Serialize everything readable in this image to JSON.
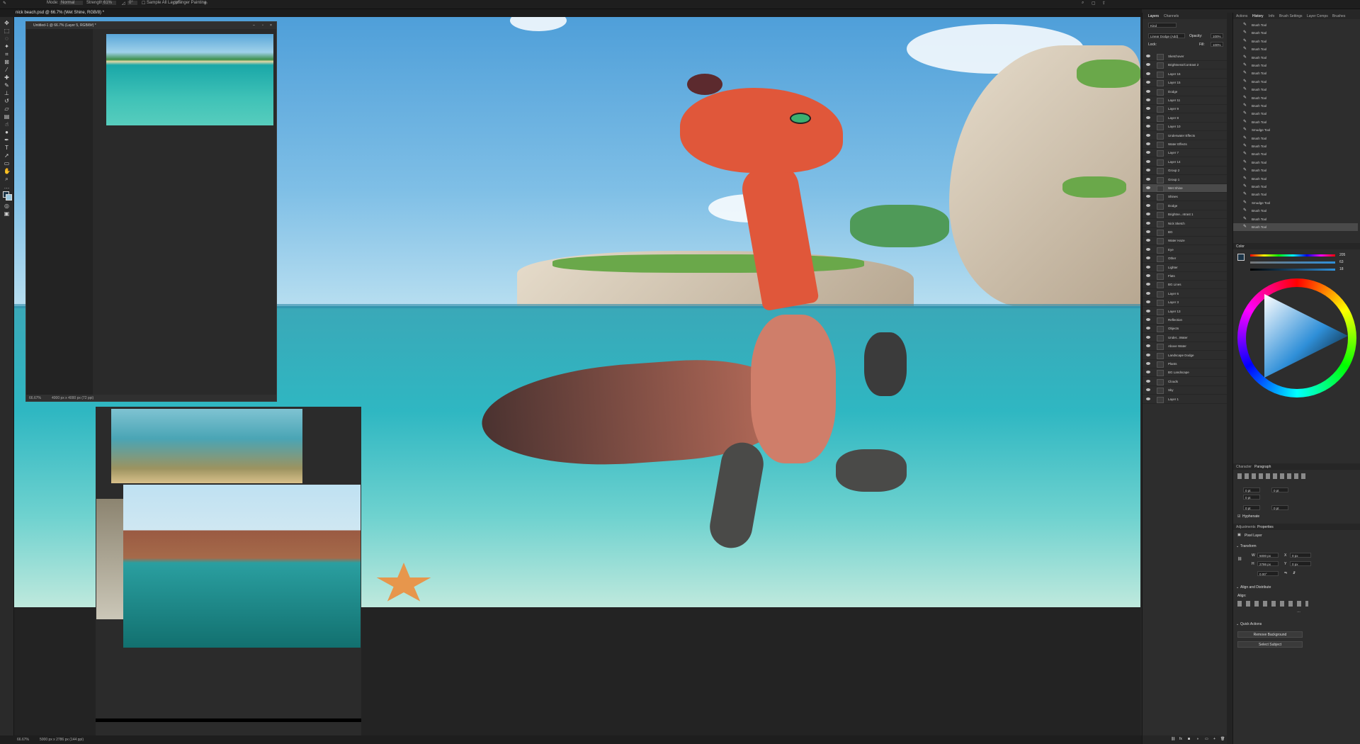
{
  "optionsbar": {
    "mode_label": "Mode:",
    "mode_value": "Normal",
    "strength_label": "Strength:",
    "strength_value": "61%",
    "angle_value": "0°",
    "sample_all_layers": "Sample All Layers",
    "finger_painting": "Finger Painting"
  },
  "document": {
    "tab_title": "nick beach.psd @ 66.7% (Wet Shine, RGB/8) *",
    "status_zoom": "66.67%",
    "status_size": "5000 px x 2786 px (144 ppi)"
  },
  "ref_window": {
    "title": "Untitled-1 @ 66.7% (Layer 5, RGB/8#) *",
    "status_zoom": "66.67%",
    "status_size": "4000 px x 4000 px (72 ppi)"
  },
  "layers_panel": {
    "tabs": [
      "Layers",
      "Channels"
    ],
    "filter_kind": "Kind",
    "blend_mode": "Linear Dodge (Add)",
    "opacity_label": "Opacity:",
    "opacity_value": "100%",
    "lock_label": "Lock:",
    "fill_label": "Fill:",
    "fill_value": "100%",
    "layers": [
      "Sketchover",
      "Brightness/Contrast 2",
      "Layer 16",
      "Layer 15",
      "Dodge",
      "Layer 11",
      "Layer 9",
      "Layer 8",
      "Layer 10",
      "Underwater Effects",
      "Water Effects",
      "Layer 7",
      "Layer 14",
      "Group 2",
      "Group 1",
      "Wet Shine",
      "Shines",
      "Dodge",
      "Brightne...ntrast 1",
      "Nick Sketch",
      "BG",
      "Water Haze",
      "Eye",
      "Other",
      "Lighter",
      "Flats",
      "BG Lines",
      "Layer 6",
      "Layer 3",
      "Layer 13",
      "Reflection",
      "Objects",
      "Under...Water",
      "Above Water",
      "Landscape Dodge",
      "Plants",
      "BG Landscape",
      "Clouds",
      "Sky",
      "Layer 1"
    ]
  },
  "history_panel": {
    "tabs": [
      "Actions",
      "History",
      "Info",
      "Brush Settings",
      "Layer Comps",
      "Brushes"
    ],
    "items": [
      "Brush Tool",
      "Brush Tool",
      "Brush Tool",
      "Brush Tool",
      "Brush Tool",
      "Brush Tool",
      "Brush Tool",
      "Brush Tool",
      "Brush Tool",
      "Brush Tool",
      "Brush Tool",
      "Brush Tool",
      "Brush Tool",
      "Smudge Tool",
      "Brush Tool",
      "Brush Tool",
      "Brush Tool",
      "Brush Tool",
      "Brush Tool",
      "Brush Tool",
      "Brush Tool",
      "Brush Tool",
      "Smudge Tool",
      "Brush Tool",
      "Brush Tool",
      "Brush Tool"
    ]
  },
  "color_panel": {
    "title": "Color",
    "h_value": "205",
    "s_value": "63",
    "b_value": "18"
  },
  "paragraph_panel": {
    "tabs": [
      "Character",
      "Paragraph"
    ],
    "indent_values": [
      "0 pt",
      "0 pt",
      "0 pt",
      "0 pt",
      "0 pt"
    ],
    "hyphenate": "Hyphenate"
  },
  "properties_panel": {
    "tabs": [
      "Adjustments",
      "Properties"
    ],
    "layer_type": "Pixel Layer",
    "transform_title": "Transform",
    "w_label": "W",
    "w_value": "5000 px",
    "h_label": "H",
    "h_value": "2786 px",
    "x_label": "X",
    "x_value": "0 px",
    "y_label": "Y",
    "y_value": "0 px",
    "angle_value": "0.00°",
    "align_title": "Align and Distribute",
    "align_label": "Align:",
    "quick_actions_title": "Quick Actions",
    "remove_bg": "Remove Background",
    "select_subject": "Select Subject"
  },
  "colors": {
    "accent_wheel_blue": "#2f8fd8",
    "ui_dark": "#2d2d2d"
  }
}
